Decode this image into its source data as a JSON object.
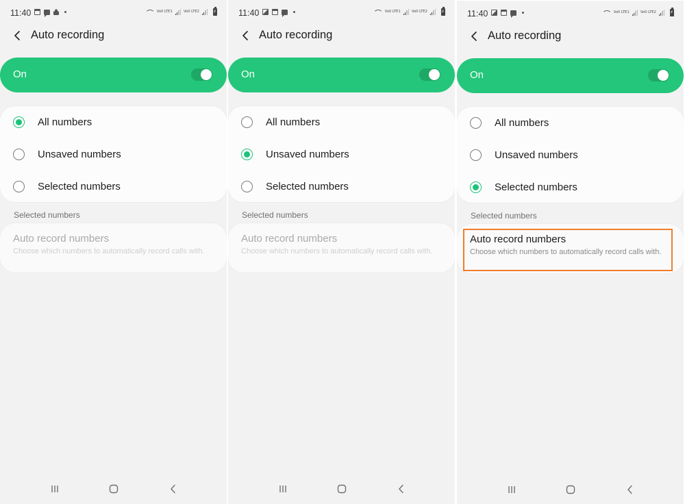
{
  "accent_color": "#23c67a",
  "highlight_color": "#f07d2b",
  "panels": [
    {
      "status_bar": {
        "time": "11:40",
        "left_icons": [
          "calendar-icon",
          "chat-icon",
          "bot-icon",
          "dot-icon"
        ],
        "sim1_label": "Vo0 LTE1",
        "sim2_label": "Vo0 LTE2"
      },
      "app_bar": {
        "title": "Auto recording",
        "back_icon": "chevron-left-icon"
      },
      "master_switch": {
        "label": "On",
        "checked": true
      },
      "options": [
        {
          "label": "All numbers",
          "checked": true
        },
        {
          "label": "Unsaved numbers",
          "checked": false
        },
        {
          "label": "Selected numbers",
          "checked": false
        }
      ],
      "section_header": "Selected numbers",
      "detail": {
        "title": "Auto record numbers",
        "subtitle": "Choose which numbers to automatically record calls with.",
        "enabled": false,
        "highlighted": false
      },
      "nav": [
        "recents-icon",
        "home-icon",
        "back-icon"
      ]
    },
    {
      "status_bar": {
        "time": "11:40",
        "left_icons": [
          "image-icon",
          "calendar-icon",
          "chat-icon",
          "dot-icon"
        ],
        "sim1_label": "Vo0 LTE1",
        "sim2_label": "Vo0 LTE2"
      },
      "app_bar": {
        "title": "Auto recording",
        "back_icon": "chevron-left-icon"
      },
      "master_switch": {
        "label": "On",
        "checked": true
      },
      "options": [
        {
          "label": "All numbers",
          "checked": false
        },
        {
          "label": "Unsaved numbers",
          "checked": true
        },
        {
          "label": "Selected numbers",
          "checked": false
        }
      ],
      "section_header": "Selected numbers",
      "detail": {
        "title": "Auto record numbers",
        "subtitle": "Choose which numbers to automatically record calls with.",
        "enabled": false,
        "highlighted": false
      },
      "nav": [
        "recents-icon",
        "home-icon",
        "back-icon"
      ]
    },
    {
      "status_bar": {
        "time": "11:40",
        "left_icons": [
          "image-icon",
          "calendar-icon",
          "chat-icon",
          "dot-icon"
        ],
        "sim1_label": "Vo0 LTE1",
        "sim2_label": "Vo0 LTE2"
      },
      "app_bar": {
        "title": "Auto recording",
        "back_icon": "chevron-left-icon"
      },
      "master_switch": {
        "label": "On",
        "checked": true
      },
      "options": [
        {
          "label": "All numbers",
          "checked": false
        },
        {
          "label": "Unsaved numbers",
          "checked": false
        },
        {
          "label": "Selected numbers",
          "checked": true
        }
      ],
      "section_header": "Selected numbers",
      "detail": {
        "title": "Auto record numbers",
        "subtitle": "Choose which numbers to automatically record calls with.",
        "enabled": true,
        "highlighted": true
      },
      "nav": [
        "recents-icon",
        "home-icon",
        "back-icon"
      ]
    }
  ]
}
